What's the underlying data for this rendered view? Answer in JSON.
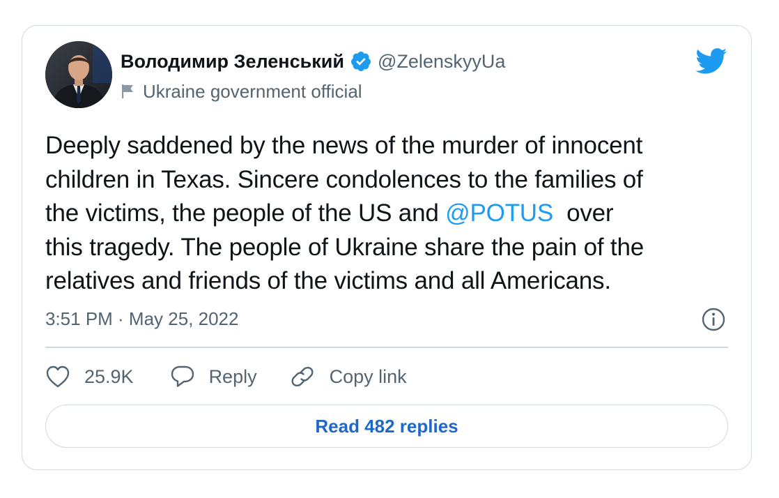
{
  "tweet": {
    "author": {
      "display_name": "Володимир Зеленський",
      "handle": "@ZelenskyyUa",
      "verified": true,
      "label": "Ukraine government official",
      "avatar_icon": "profile-photo"
    },
    "text_lines": [
      {
        "before": "Deeply saddened by the news of the murder of innocent",
        "mention": "",
        "after": ""
      },
      {
        "before": "children in Texas. Sincere condolences to the families of",
        "mention": "",
        "after": ""
      },
      {
        "before": "the victims, the people of the US and ",
        "mention": "@POTUS",
        "after": "  over"
      },
      {
        "before": "this tragedy. The people of Ukraine share the pain of the",
        "mention": "",
        "after": ""
      },
      {
        "before": "relatives and friends of the victims and all Americans.",
        "mention": "",
        "after": ""
      }
    ],
    "timestamp": "3:51 PM · May 25, 2022",
    "actions": {
      "like_count": "25.9K",
      "reply_label": "Reply",
      "copy_link_label": "Copy link"
    },
    "read_replies_label": "Read 482 replies"
  },
  "icons": {
    "brand": "twitter-bird-icon",
    "verified": "verified-badge-icon",
    "label": "flag-icon",
    "info": "info-icon",
    "like": "heart-icon",
    "reply": "speech-bubble-icon",
    "copy_link": "link-icon"
  },
  "colors": {
    "accent": "#1d9bf0",
    "button_text": "#1d68c9",
    "secondary_text": "#536471",
    "primary_text": "#0f1419",
    "border": "#cfd9de"
  }
}
